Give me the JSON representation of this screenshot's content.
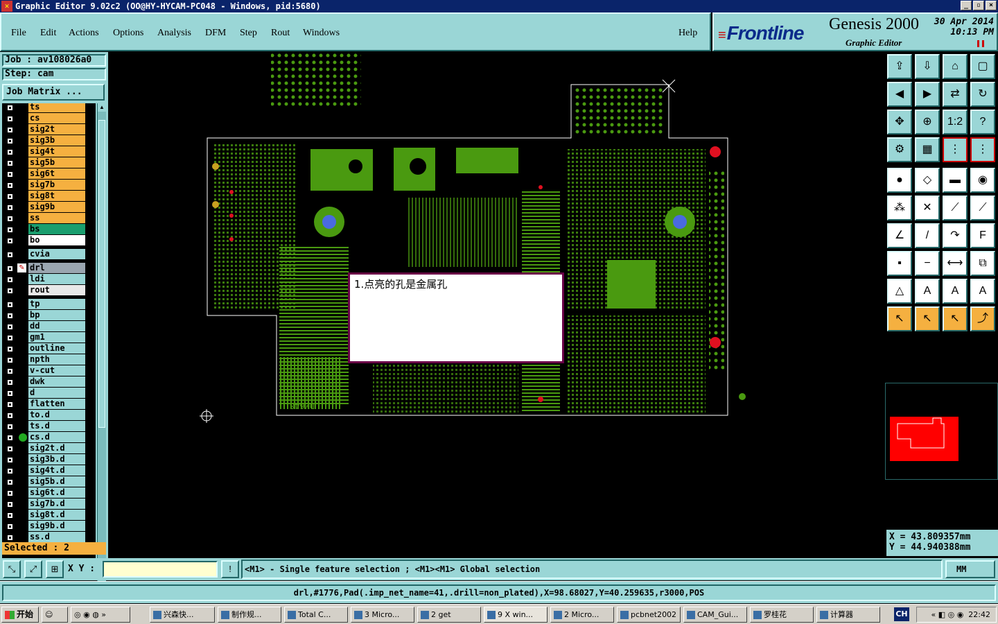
{
  "window": {
    "title": "Graphic Editor 9.02c2  (OO@HY-HYCAM-PC048 - Windows, pid:5680)",
    "controls": [
      "_",
      "▫",
      "×"
    ]
  },
  "menu": {
    "items": [
      "File",
      "Edit",
      "Actions",
      "Options",
      "Analysis",
      "DFM",
      "Step",
      "Rout",
      "Windows"
    ],
    "help": "Help"
  },
  "brand": {
    "logo": "Frontline",
    "product": "Genesis 2000",
    "subtitle": "Graphic Editor",
    "date": "30 Apr 2014",
    "time": "10:13 PM"
  },
  "job": {
    "job_label": "Job : av108026a0",
    "step_label": "Step: cam",
    "matrix_button": "Job Matrix ..."
  },
  "layers": [
    {
      "name": "ts",
      "kind": "sig"
    },
    {
      "name": "cs",
      "kind": "sig"
    },
    {
      "name": "sig2t",
      "kind": "sig"
    },
    {
      "name": "sig3b",
      "kind": "sig"
    },
    {
      "name": "sig4t",
      "kind": "sig"
    },
    {
      "name": "sig5b",
      "kind": "sig"
    },
    {
      "name": "sig6t",
      "kind": "sig"
    },
    {
      "name": "sig7b",
      "kind": "sig"
    },
    {
      "name": "sig8t",
      "kind": "sig"
    },
    {
      "name": "sig9b",
      "kind": "sig"
    },
    {
      "name": "ss",
      "kind": "sig"
    },
    {
      "name": "bs",
      "kind": "bs"
    },
    {
      "name": "bo",
      "kind": "bo"
    },
    {
      "name": "",
      "kind": "gap"
    },
    {
      "name": "cvia",
      "kind": "doc"
    },
    {
      "name": "",
      "kind": "gap"
    },
    {
      "name": "drl",
      "kind": "sel"
    },
    {
      "name": "ldi",
      "kind": "doc"
    },
    {
      "name": "rout",
      "kind": "rout"
    },
    {
      "name": "",
      "kind": "gap"
    },
    {
      "name": "tp",
      "kind": "doc"
    },
    {
      "name": "bp",
      "kind": "doc"
    },
    {
      "name": "dd",
      "kind": "doc"
    },
    {
      "name": "gm1",
      "kind": "doc"
    },
    {
      "name": "outline",
      "kind": "doc"
    },
    {
      "name": "npth",
      "kind": "doc"
    },
    {
      "name": "v-cut",
      "kind": "doc"
    },
    {
      "name": "dwk",
      "kind": "doc"
    },
    {
      "name": "d",
      "kind": "doc"
    },
    {
      "name": "flatten",
      "kind": "doc"
    },
    {
      "name": "to.d",
      "kind": "doc"
    },
    {
      "name": "ts.d",
      "kind": "doc"
    },
    {
      "name": "cs.d",
      "kind": "doc"
    },
    {
      "name": "sig2t.d",
      "kind": "doc"
    },
    {
      "name": "sig3b.d",
      "kind": "doc"
    },
    {
      "name": "sig4t.d",
      "kind": "doc"
    },
    {
      "name": "sig5b.d",
      "kind": "doc"
    },
    {
      "name": "sig6t.d",
      "kind": "doc"
    },
    {
      "name": "sig7b.d",
      "kind": "doc"
    },
    {
      "name": "sig8t.d",
      "kind": "doc"
    },
    {
      "name": "sig9b.d",
      "kind": "doc"
    },
    {
      "name": "ss.d",
      "kind": "doc"
    }
  ],
  "selected": "Selected : 2",
  "canvas": {
    "note": "1.点亮的孔是金属孔",
    "board_text": "DM648"
  },
  "coords": {
    "x": "X  = 43.809357mm",
    "y": "Y  = 44.940388mm"
  },
  "bottom": {
    "xy_label": "X Y :",
    "xy_value": "",
    "alert": "!",
    "prompt": "<M1> - Single feature selection ; <M1><M1> Global selection",
    "units": "MM"
  },
  "info": "drl,#1776,Pad(.imp_net_name=41,.drill=non_plated),X=98.68027,Y=40.259635,r3000,POS",
  "taskbar": {
    "start": "开始",
    "tasks": [
      "兴森快...",
      "制作规...",
      "Total C...",
      "3 Micro...",
      "2 get",
      "9 X win...",
      "2 Micro...",
      "pcbnet2002",
      "CAM_Gui...",
      "罗桂花",
      "计算器"
    ],
    "lang": "CH",
    "clock": "22:42"
  },
  "colors": {
    "panel": "#9ad6d6",
    "signal_layer": "#f5b040",
    "copper": "#4a9a10",
    "board_outline": "#ffffff"
  }
}
